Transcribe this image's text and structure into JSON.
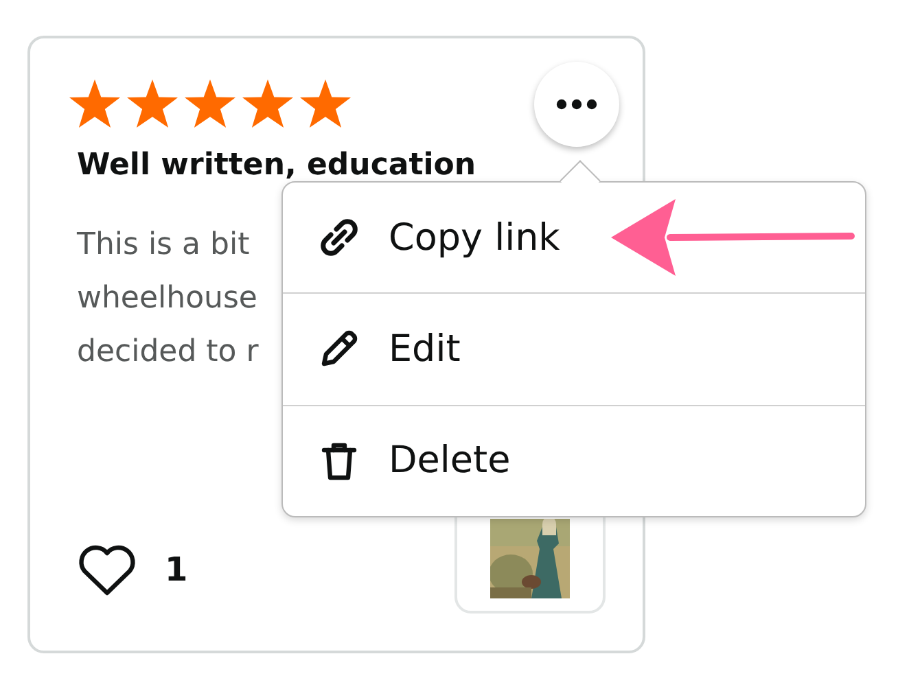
{
  "review": {
    "stars": 5,
    "title": "Well written, education",
    "body_lines": [
      "This is a bit",
      "wheelhouse",
      "decided to r"
    ],
    "likes": "1"
  },
  "menu": {
    "items": [
      {
        "kind": "link",
        "label": "Copy link"
      },
      {
        "kind": "edit",
        "label": "Edit"
      },
      {
        "kind": "delete",
        "label": "Delete"
      }
    ]
  }
}
